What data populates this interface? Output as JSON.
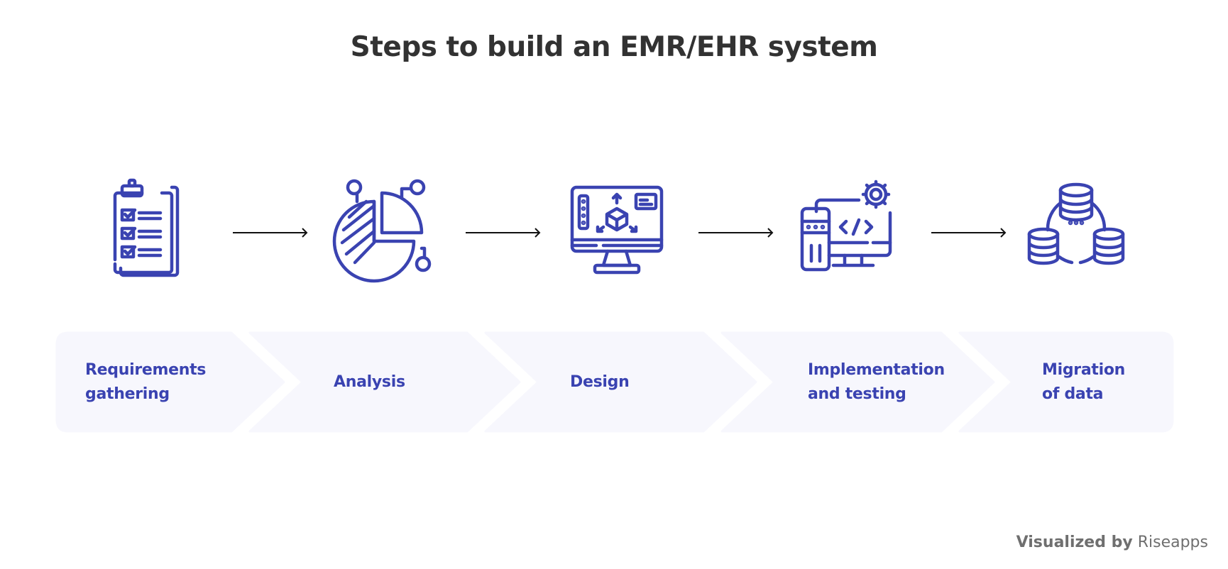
{
  "title": "Steps to build an EMR/EHR system",
  "colors": {
    "accent": "#3a43b1",
    "band": "#f7f7fd",
    "arrow": "#111111",
    "title": "#323232",
    "footer": "#6f6f6f"
  },
  "steps": [
    {
      "label": "Requirements\ngathering",
      "icon": "clipboard-checklist-icon"
    },
    {
      "label": "Analysis",
      "icon": "pie-chart-analysis-icon"
    },
    {
      "label": "Design",
      "icon": "monitor-3d-design-icon"
    },
    {
      "label": "Implementation\nand testing",
      "icon": "computer-code-gear-icon"
    },
    {
      "label": "Migration\nof data",
      "icon": "database-network-icon"
    }
  ],
  "footer": {
    "prefix": "Visualized by",
    "brand": "Riseapps"
  }
}
